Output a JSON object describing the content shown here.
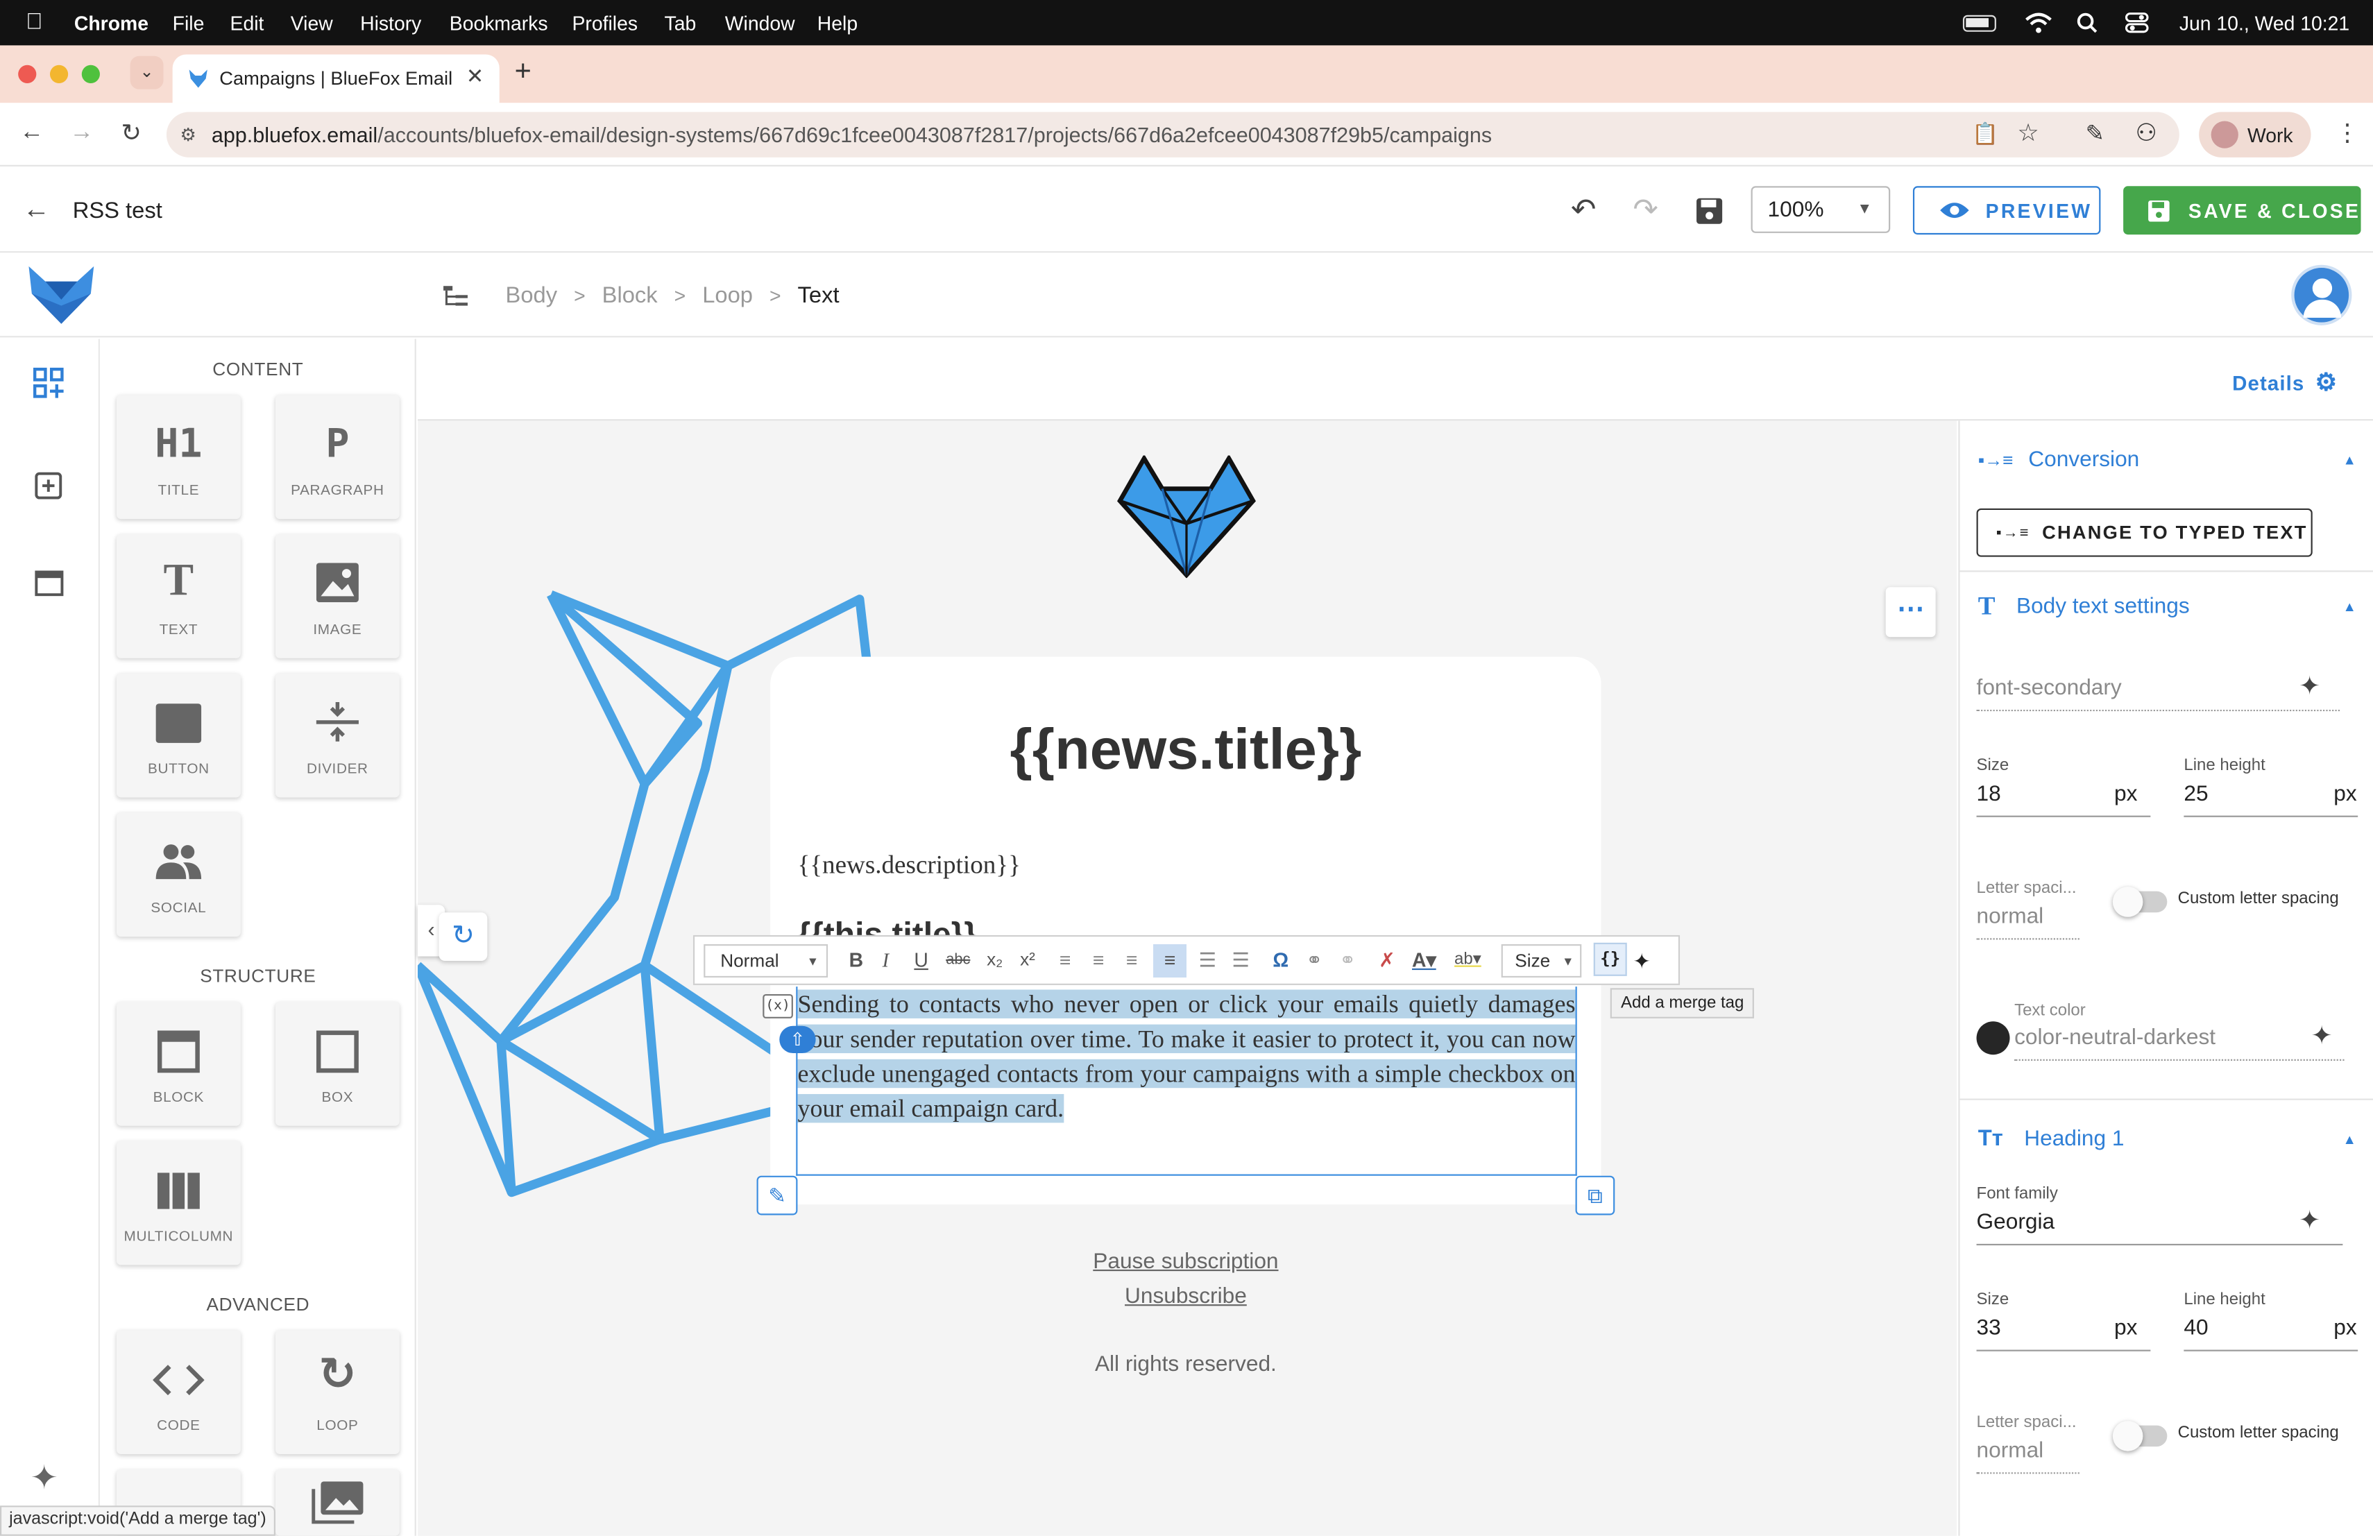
{
  "macos_menubar": {
    "app": "Chrome",
    "menus": [
      "File",
      "Edit",
      "View",
      "History",
      "Bookmarks",
      "Profiles",
      "Tab",
      "Window",
      "Help"
    ],
    "datetime": "Jun 10., Wed  10:21"
  },
  "browser": {
    "tab_title": "Campaigns | BlueFox Email",
    "url_host": "app.bluefox.email",
    "url_path": "/accounts/bluefox-email/design-systems/667d69c1fcee0043087f2817/projects/667d6a2efcee0043087f29b5/campaigns",
    "profile": "Work",
    "status_text": "javascript:void('Add a merge tag')"
  },
  "header": {
    "title": "RSS test",
    "zoom": "100%",
    "preview_label": "PREVIEW",
    "save_close_label": "SAVE & CLOSE"
  },
  "breadcrumb": [
    "Body",
    "Block",
    "Loop",
    "Text"
  ],
  "sidebar": {
    "content_title": "CONTENT",
    "content_items": [
      {
        "icon": "H1",
        "label": "TITLE"
      },
      {
        "icon": "P",
        "label": "PARAGRAPH"
      },
      {
        "icon": "T",
        "label": "TEXT"
      },
      {
        "icon": "image",
        "label": "IMAGE"
      },
      {
        "icon": "button",
        "label": "BUTTON"
      },
      {
        "icon": "divider",
        "label": "DIVIDER"
      },
      {
        "icon": "people",
        "label": "SOCIAL"
      }
    ],
    "structure_title": "STRUCTURE",
    "structure_items": [
      {
        "icon": "block",
        "label": "BLOCK"
      },
      {
        "icon": "box",
        "label": "BOX"
      },
      {
        "icon": "columns",
        "label": "MULTICOLUMN"
      }
    ],
    "advanced_title": "ADVANCED",
    "advanced_items": [
      {
        "icon": "code",
        "label": "CODE"
      },
      {
        "icon": "refresh",
        "label": "LOOP"
      }
    ]
  },
  "details_label": "Details",
  "email": {
    "news_title": "{{news.title}}",
    "news_description": "{{news.description}}",
    "this_title": "{{this.title}}",
    "selected_text": "Sending to contacts who never open or click your emails quietly damages your sender reputation over time. To make it easier to protect it, you can now exclude unengaged contacts from your campaigns with a simple checkbox on your email campaign card.",
    "pause_link": "Pause subscription",
    "unsubscribe_link": "Unsubscribe",
    "rights": "All rights reserved."
  },
  "editor_toolbar": {
    "format": "Normal",
    "size": "Size",
    "tooltip": "Add a merge tag"
  },
  "panel": {
    "conversion_title": "Conversion",
    "change_button": "CHANGE TO TYPED TEXT",
    "body_title": "Body text settings",
    "body_font": "font-secondary",
    "size_label": "Size",
    "line_height_label": "Line height",
    "body_size": "18",
    "body_line_height": "25",
    "unit": "px",
    "letter_spacing_label": "Letter spaci...",
    "letter_spacing_value": "normal",
    "custom_spacing_label": "Custom letter spacing",
    "text_color_label": "Text color",
    "text_color_value": "color-neutral-darkest",
    "heading_title": "Heading 1",
    "font_family_label": "Font family",
    "heading_font": "Georgia",
    "heading_size": "33",
    "heading_line_height": "40"
  },
  "colors": {
    "accent": "#2f7fd6",
    "save_green": "#46a74b",
    "selection": "#b5d3e8",
    "tab_strip": "#f8ddd3"
  }
}
